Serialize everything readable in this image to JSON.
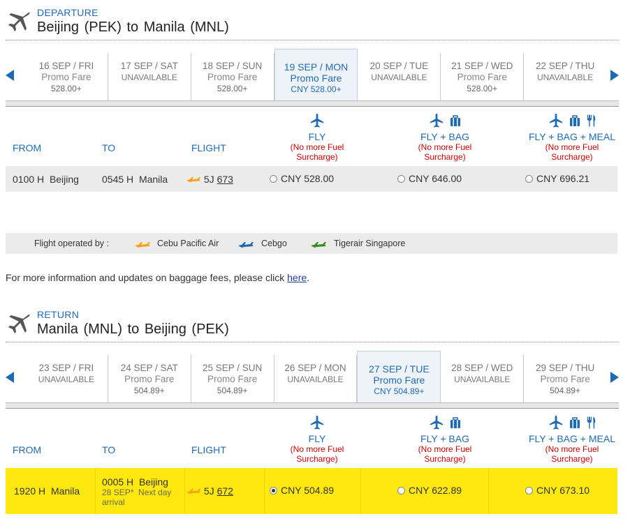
{
  "departure": {
    "kicker": "DEPARTURE",
    "title": "Beijing (PEK) to Manila (MNL)",
    "dates": [
      {
        "date": "16 SEP / FRI",
        "fare": "Promo Fare",
        "price": "528.00+"
      },
      {
        "date": "17 SEP / SAT",
        "fare": "UNAVAILABLE",
        "price": ""
      },
      {
        "date": "18 SEP / SUN",
        "fare": "Promo Fare",
        "price": "528.00+"
      },
      {
        "date": "19 SEP / MON",
        "fare": "Promo Fare",
        "price": "CNY 528.00+"
      },
      {
        "date": "20 SEP / TUE",
        "fare": "UNAVAILABLE",
        "price": ""
      },
      {
        "date": "21 SEP / WED",
        "fare": "Promo Fare",
        "price": "528.00+"
      },
      {
        "date": "22 SEP / THU",
        "fare": "UNAVAILABLE",
        "price": ""
      }
    ],
    "headers": {
      "from": "FROM",
      "to": "TO",
      "flight": "FLIGHT"
    },
    "fares": [
      {
        "name": "FLY",
        "note1": "(No more Fuel",
        "note2": "Surcharge)"
      },
      {
        "name": "FLY + BAG",
        "note1": "(No more Fuel",
        "note2": "Surcharge)"
      },
      {
        "name": "FLY + BAG + MEAL",
        "note1": "(No more Fuel",
        "note2": "Surcharge)"
      }
    ],
    "flight": {
      "dep_time": "0100 H",
      "dep_city": "Beijing",
      "arr_time": "0545 H",
      "arr_city": "Manila",
      "carrier": "5J",
      "number": "673",
      "prices": [
        "CNY 528.00",
        "CNY 646.00",
        "CNY 696.21"
      ]
    }
  },
  "legend": {
    "label": "Flight operated by :",
    "airlines": [
      "Cebu Pacific Air",
      "Cebgo",
      "Tigerair Singapore"
    ]
  },
  "info": {
    "text": "For more information and updates on baggage fees, please click ",
    "link": "here",
    "end": "."
  },
  "return": {
    "kicker": "RETURN",
    "title": "Manila (MNL) to Beijing (PEK)",
    "dates": [
      {
        "date": "23 SEP / FRI",
        "fare": "UNAVAILABLE",
        "price": ""
      },
      {
        "date": "24 SEP / SAT",
        "fare": "Promo Fare",
        "price": "504.89+"
      },
      {
        "date": "25 SEP / SUN",
        "fare": "Promo Fare",
        "price": "504.89+"
      },
      {
        "date": "26 SEP / MON",
        "fare": "UNAVAILABLE",
        "price": ""
      },
      {
        "date": "27 SEP / TUE",
        "fare": "Promo Fare",
        "price": "CNY 504.89+"
      },
      {
        "date": "28 SEP / WED",
        "fare": "UNAVAILABLE",
        "price": ""
      },
      {
        "date": "29 SEP / THU",
        "fare": "Promo Fare",
        "price": "504.89+"
      }
    ],
    "headers": {
      "from": "FROM",
      "to": "TO",
      "flight": "FLIGHT"
    },
    "fares": [
      {
        "name": "FLY",
        "note1": "(No more Fuel",
        "note2": "Surcharge)"
      },
      {
        "name": "FLY + BAG",
        "note1": "(No more Fuel",
        "note2": "Surcharge)"
      },
      {
        "name": "FLY + BAG + MEAL",
        "note1": "(No more Fuel",
        "note2": "Surcharge)"
      }
    ],
    "flight": {
      "dep_time": "1920 H",
      "dep_city": "Manila",
      "arr_time": "0005 H",
      "arr_city": "Beijing",
      "arr_date": "28 SEP*",
      "next_day": "Next day",
      "arrival_word": "arrival",
      "carrier": "5J",
      "number": "672",
      "prices": [
        "CNY 504.89",
        "CNY 622.89",
        "CNY 673.10"
      ]
    }
  },
  "colors": {
    "accent": "#1f6bb3",
    "surcharge": "#cc0000",
    "selected_row": "#ffe710",
    "cebu": "#f7a21b",
    "cebgo": "#1f6bb3",
    "tigerair": "#3a8a1f"
  }
}
